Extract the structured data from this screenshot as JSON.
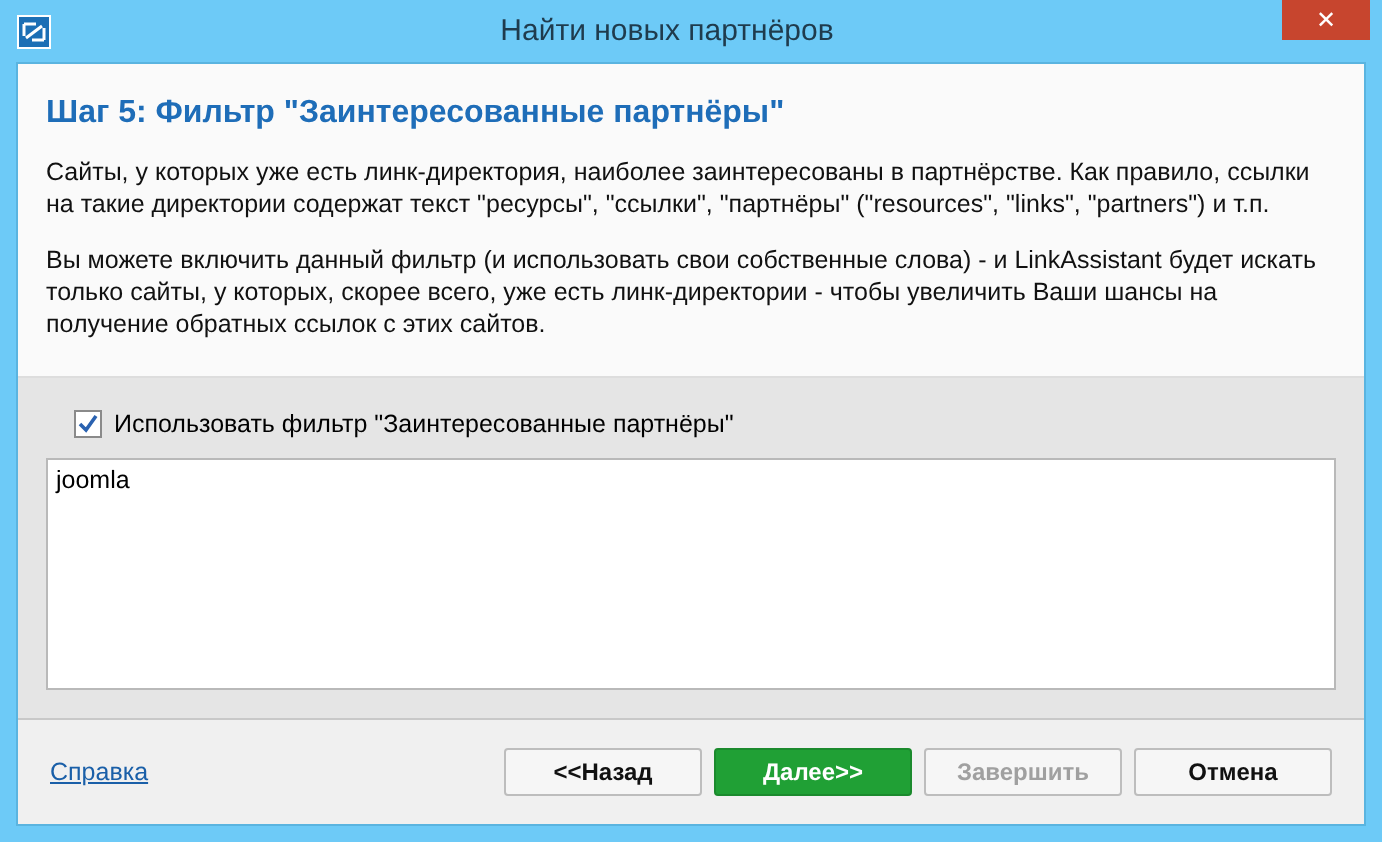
{
  "window": {
    "title": "Найти новых партнёров",
    "close": "✕"
  },
  "step_title": "Шаг 5: Фильтр \"Заинтересованные партнёры\"",
  "paragraphs": [
    "Сайты, у которых уже есть линк-директория, наиболее заинтересованы в партнёрстве. Как правило, ссылки на такие директории содержат текст \"ресурсы\", \"ссылки\", \"партнёры\" (\"resources\", \"links\", \"partners\") и т.п.",
    "Вы можете включить данный фильтр (и использовать свои собственные слова) - и LinkAssistant будет искать только сайты, у которых, скорее всего, уже есть линк-директории - чтобы увеличить Ваши шансы на получение обратных ссылок с этих сайтов."
  ],
  "filter": {
    "label": "Использовать фильтр \"Заинтересованные партнёры\"",
    "checked": true
  },
  "keywords": {
    "value": "joomla"
  },
  "help_link": "Справка",
  "buttons": [
    {
      "label": "<<Назад",
      "kind": "normal",
      "disabled": false
    },
    {
      "label": "Далее>>",
      "kind": "primary",
      "disabled": false
    },
    {
      "label": "Завершить",
      "kind": "normal",
      "disabled": true
    },
    {
      "label": "Отмена",
      "kind": "normal",
      "disabled": false
    }
  ]
}
